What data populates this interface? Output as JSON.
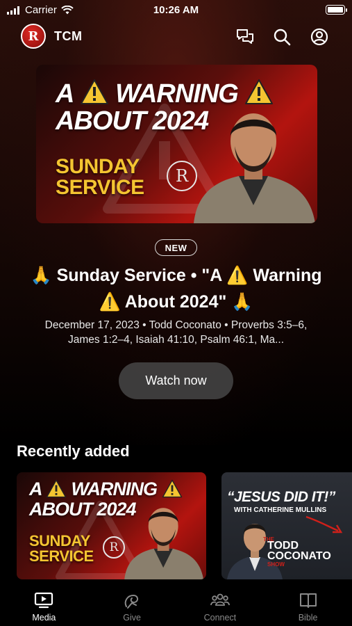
{
  "status_bar": {
    "carrier": "Carrier",
    "time": "10:26 AM"
  },
  "header": {
    "logo_text": "R",
    "app_name": "TCM"
  },
  "hero": {
    "thumbnail": {
      "line1_a": "A",
      "line1_b": "WARNING",
      "line2": "ABOUT 2024",
      "sub1": "SUNDAY",
      "sub2": "SERVICE",
      "logo": "R"
    },
    "badge": "NEW",
    "title": "🙏 Sunday Service • \"A ⚠️ Warning ⚠️ About 2024\" 🙏",
    "meta": "December 17, 2023 • Todd Coconato • Proverbs 3:5–6, James 1:2–4, Isaiah 41:10, Psalm 46:1, Ma...",
    "watch_label": "Watch now"
  },
  "recent": {
    "title": "Recently added",
    "cards": [
      {
        "line1_a": "A",
        "line1_b": "WARNING",
        "line2": "ABOUT 2024",
        "sub1": "SUNDAY",
        "sub2": "SERVICE",
        "logo": "R"
      },
      {
        "quote": "“JESUS DID IT!”",
        "with": "WITH CATHERINE MULLINS",
        "show_the": "THE",
        "show_name1": "TODD",
        "show_name2": "COCONATO",
        "show_word": "SHOW"
      }
    ]
  },
  "tabs": [
    {
      "label": "Media",
      "icon": "tv-play-icon",
      "active": true
    },
    {
      "label": "Give",
      "icon": "give-icon",
      "active": false
    },
    {
      "label": "Connect",
      "icon": "people-icon",
      "active": false
    },
    {
      "label": "Bible",
      "icon": "book-icon",
      "active": false
    }
  ],
  "colors": {
    "accent_yellow": "#f4c531",
    "brand_red": "#c3140f",
    "button_bg": "#464646"
  }
}
